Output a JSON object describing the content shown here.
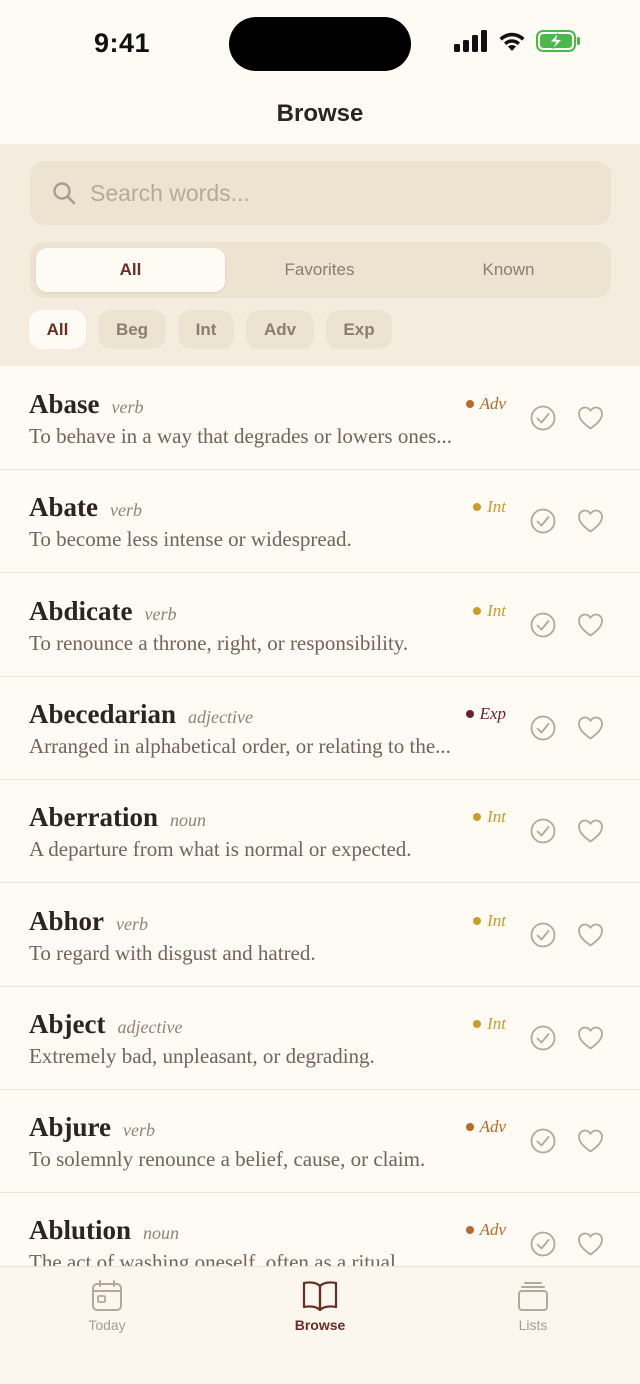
{
  "status": {
    "time": "9:41"
  },
  "header": {
    "title": "Browse"
  },
  "search": {
    "placeholder": "Search words..."
  },
  "segments": [
    {
      "label": "All",
      "active": true
    },
    {
      "label": "Favorites",
      "active": false
    },
    {
      "label": "Known",
      "active": false
    }
  ],
  "level_chips": [
    {
      "label": "All",
      "active": true
    },
    {
      "label": "Beg",
      "active": false
    },
    {
      "label": "Int",
      "active": false
    },
    {
      "label": "Adv",
      "active": false
    },
    {
      "label": "Exp",
      "active": false
    }
  ],
  "level_colors": {
    "Adv": "#b86a2a",
    "Int": "#c99d2c",
    "Exp": "#6d2030"
  },
  "words": [
    {
      "word": "Abase",
      "pos": "verb",
      "level": "Adv",
      "definition": "To behave in a way that degrades or lowers ones..."
    },
    {
      "word": "Abate",
      "pos": "verb",
      "level": "Int",
      "definition": "To become less intense or widespread."
    },
    {
      "word": "Abdicate",
      "pos": "verb",
      "level": "Int",
      "definition": "To renounce a throne, right, or responsibility."
    },
    {
      "word": "Abecedarian",
      "pos": "adjective",
      "level": "Exp",
      "definition": "Arranged in alphabetical order, or relating to the..."
    },
    {
      "word": "Aberration",
      "pos": "noun",
      "level": "Int",
      "definition": "A departure from what is normal or expected."
    },
    {
      "word": "Abhor",
      "pos": "verb",
      "level": "Int",
      "definition": "To regard with disgust and hatred."
    },
    {
      "word": "Abject",
      "pos": "adjective",
      "level": "Int",
      "definition": "Extremely bad, unpleasant, or degrading."
    },
    {
      "word": "Abjure",
      "pos": "verb",
      "level": "Adv",
      "definition": "To solemnly renounce a belief, cause, or claim."
    },
    {
      "word": "Ablution",
      "pos": "noun",
      "level": "Adv",
      "definition": "The act of washing oneself, often as a ritual."
    }
  ],
  "tabs": [
    {
      "label": "Today",
      "icon": "calendar-icon",
      "active": false
    },
    {
      "label": "Browse",
      "icon": "book-icon",
      "active": true
    },
    {
      "label": "Lists",
      "icon": "stack-icon",
      "active": false
    }
  ],
  "colors": {
    "accent": "#6a2d24",
    "background": "#fdfbf4",
    "panel": "#f4eddf"
  }
}
